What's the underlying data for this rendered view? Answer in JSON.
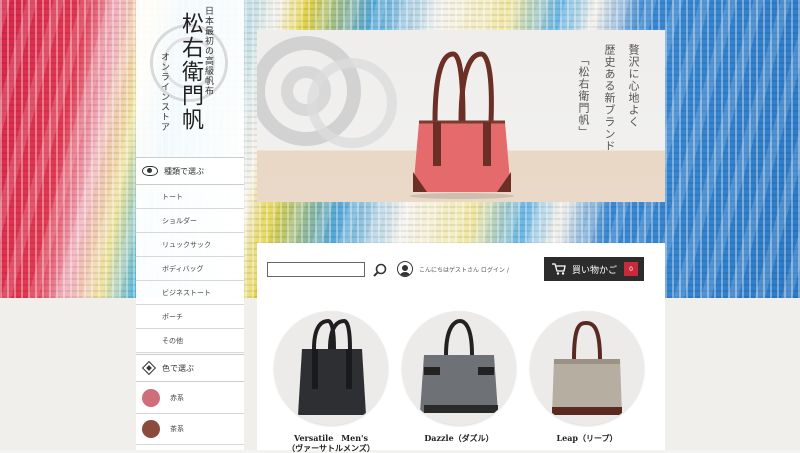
{
  "brand": {
    "tagline": "日本最初の高級帆布",
    "name": "松右衛門帆",
    "online_store": "オンラインストア"
  },
  "sidebar": {
    "type_heading": "種類で選ぶ",
    "type_items": [
      "トート",
      "ショルダー",
      "リュックサック",
      "ボディバッグ",
      "ビジネストート",
      "ポーチ",
      "その他"
    ],
    "color_heading": "色で選ぶ",
    "color_items": [
      {
        "label": "赤系",
        "swatch": "#cf6d7a"
      },
      {
        "label": "茶系",
        "swatch": "#8b4a3c"
      }
    ]
  },
  "hero": {
    "copy_line1": "贅沢に心地よく",
    "copy_line2": "歴史ある新ブランド",
    "copy_line3": "「松右衛門帆」"
  },
  "header": {
    "search_placeholder": "",
    "greeting": "こんにちはゲストさん ログイン /",
    "cart_label": "買い物かご",
    "cart_count": "0"
  },
  "products": [
    {
      "name_line1": "Versatile　Men's",
      "name_line2": "（ヴァーサトルメンズ）",
      "bag_color": "#2d2f33"
    },
    {
      "name_line1": "Dazzle（ダズル）",
      "name_line2": "",
      "bag_color": "#6e7175"
    },
    {
      "name_line1": "Leap（リープ）",
      "name_line2": "",
      "bag_color": "#b7aea2"
    }
  ],
  "colors": {
    "accent_red": "#c92a3a",
    "cart_bg": "#2c2c2c",
    "hero_bag": "#e46a6c"
  }
}
